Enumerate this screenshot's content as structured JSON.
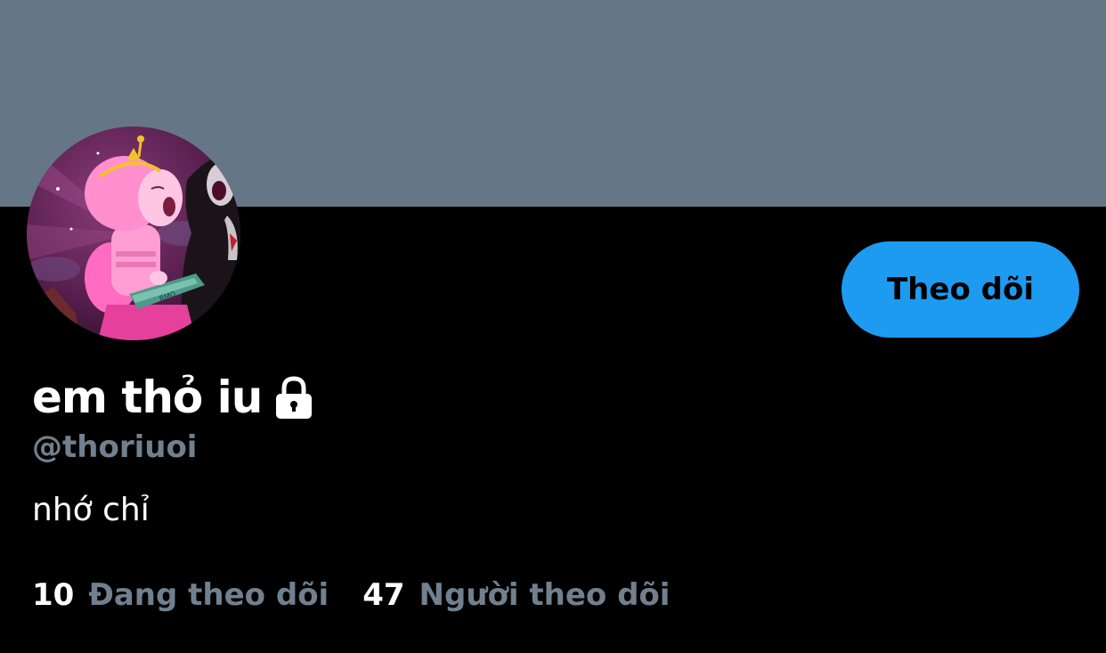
{
  "colors": {
    "banner": "#657786",
    "background": "#000000",
    "accent": "#1d9bf0",
    "muted": "#71808e",
    "text": "#ffffff"
  },
  "profile": {
    "display_name": "em thỏ iu",
    "protected_icon": "lock-icon",
    "handle": "@thoriuoi",
    "bio": "nhớ chỉ",
    "follow_button_label": "Theo dõi",
    "avatar_icon": "cartoon-avatar"
  },
  "stats": {
    "following_count": "10",
    "following_label": "Đang theo dõi",
    "followers_count": "47",
    "followers_label": "Người theo dõi"
  }
}
